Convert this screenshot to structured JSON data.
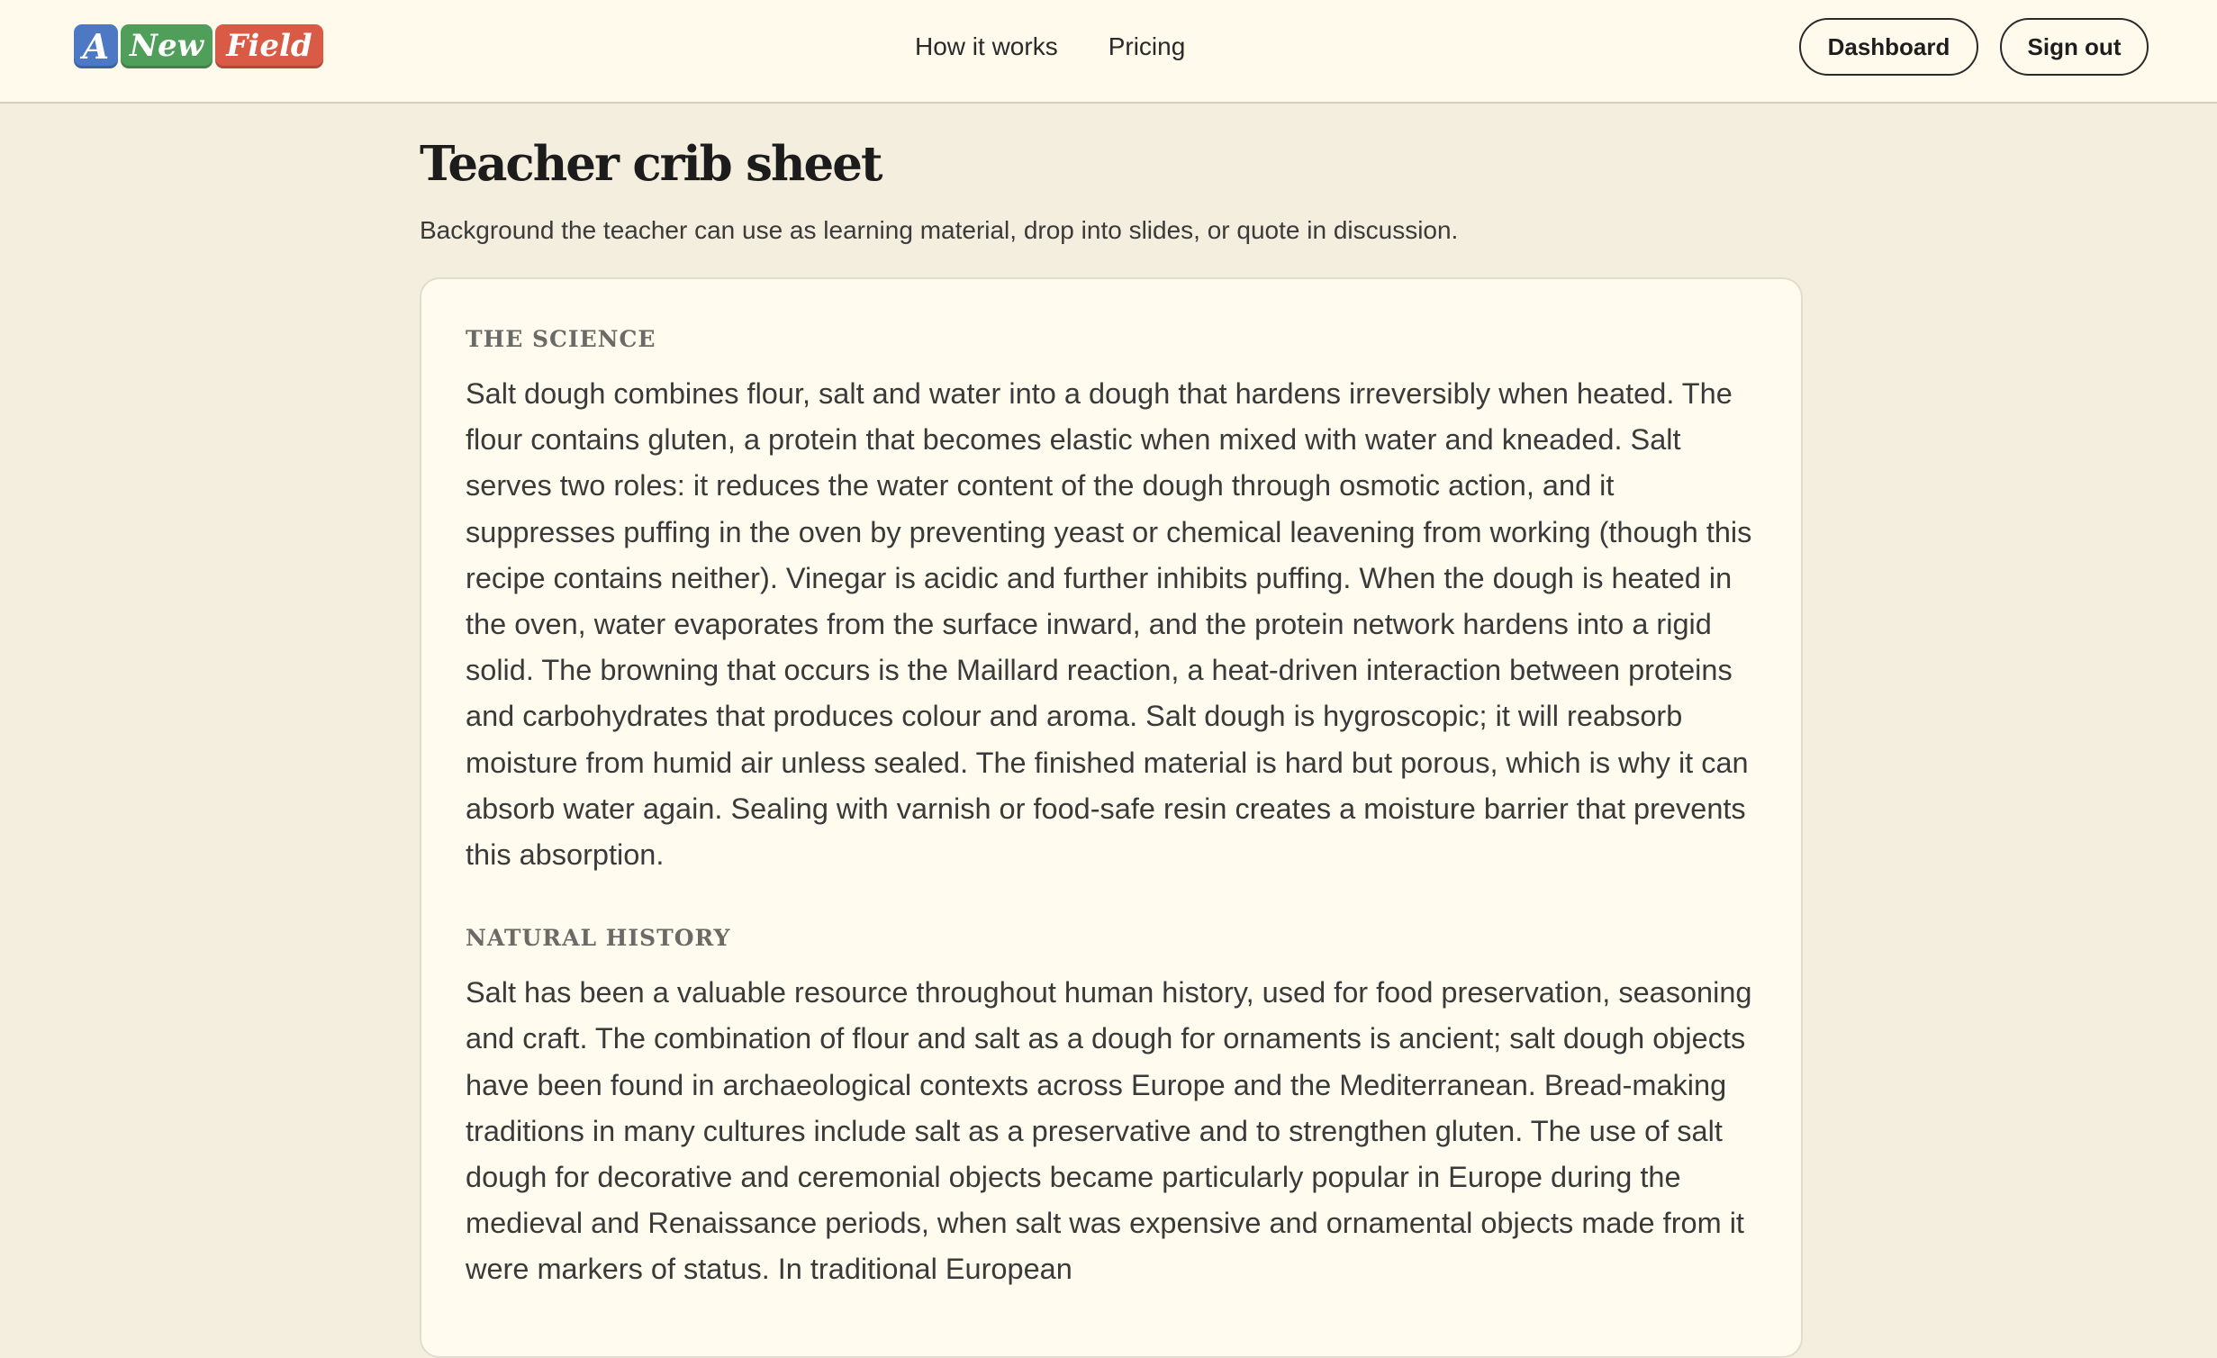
{
  "header": {
    "logo": {
      "tiles": [
        "A",
        "New",
        "Field"
      ],
      "colors": [
        "#4d78c3",
        "#4f9e5a",
        "#d95a45"
      ]
    },
    "nav": [
      {
        "label": "How it works"
      },
      {
        "label": "Pricing"
      }
    ],
    "dashboard_label": "Dashboard",
    "signout_label": "Sign out"
  },
  "main": {
    "title": "Teacher crib sheet",
    "subtitle": "Background the teacher can use as learning material, drop into slides, or quote in discussion.",
    "sections": [
      {
        "heading": "THE SCIENCE",
        "body": "Salt dough combines flour, salt and water into a dough that hardens irreversibly when heated. The flour contains gluten, a protein that becomes elastic when mixed with water and kneaded. Salt serves two roles: it reduces the water content of the dough through osmotic action, and it suppresses puffing in the oven by preventing yeast or chemical leavening from working (though this recipe contains neither). Vinegar is acidic and further inhibits puffing. When the dough is heated in the oven, water evaporates from the surface inward, and the protein network hardens into a rigid solid. The browning that occurs is the Maillard reaction, a heat-driven interaction between proteins and carbohydrates that produces colour and aroma. Salt dough is hygroscopic; it will reabsorb moisture from humid air unless sealed. The finished material is hard but porous, which is why it can absorb water again. Sealing with varnish or food-safe resin creates a moisture barrier that prevents this absorption."
      },
      {
        "heading": "NATURAL HISTORY",
        "body": "Salt has been a valuable resource throughout human history, used for food preservation, seasoning and craft. The combination of flour and salt as a dough for ornaments is ancient; salt dough objects have been found in archaeological contexts across Europe and the Mediterranean. Bread-making traditions in many cultures include salt as a preservative and to strengthen gluten. The use of salt dough for decorative and ceremonial objects became particularly popular in Europe during the medieval and Renaissance periods, when salt was expensive and ornamental objects made from it were markers of status. In traditional European"
      }
    ]
  }
}
